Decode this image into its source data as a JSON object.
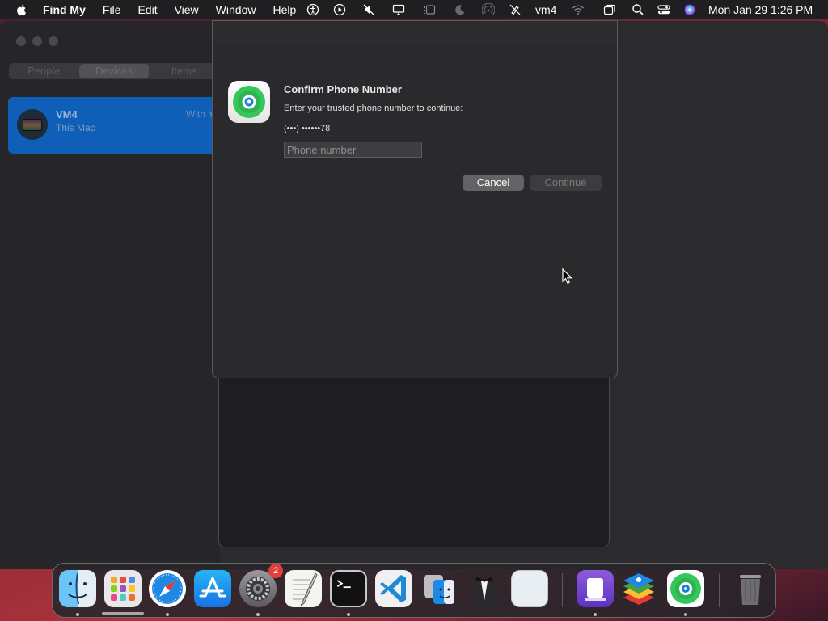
{
  "menubar": {
    "app_name": "Find My",
    "menus": [
      "File",
      "Edit",
      "View",
      "Window",
      "Help"
    ],
    "user": "vm4",
    "datetime": "Mon Jan 29  1:26 PM"
  },
  "sidebar": {
    "tabs": [
      "People",
      "Devices",
      "Items"
    ],
    "active_tab": "Devices",
    "device": {
      "name": "VM4",
      "subtitle": "This Mac",
      "status": "With Y"
    }
  },
  "dialog": {
    "title": "Confirm Phone Number",
    "message": "Enter your trusted phone number to continue:",
    "masked_phone": "(•••) ••••••78",
    "input_placeholder": "Phone number",
    "input_value": "",
    "cancel_label": "Cancel",
    "continue_label": "Continue"
  },
  "dock": {
    "apps": [
      {
        "name": "Finder",
        "running": true
      },
      {
        "name": "Launchpad",
        "running": false
      },
      {
        "name": "Safari",
        "running": true
      },
      {
        "name": "App Store",
        "running": false
      },
      {
        "name": "System Settings",
        "running": true,
        "badge": "2"
      },
      {
        "name": "TextEdit",
        "running": false
      },
      {
        "name": "Terminal",
        "running": true
      },
      {
        "name": "Visual Studio Code",
        "running": false
      },
      {
        "name": "Migration Assistant",
        "running": false
      },
      {
        "name": "Bartender",
        "running": false
      },
      {
        "name": "Preview",
        "running": false
      },
      {
        "name": "Simulator",
        "running": true
      },
      {
        "name": "BlueStacks",
        "running": false
      },
      {
        "name": "Find My",
        "running": true
      },
      {
        "name": "Trash",
        "running": false
      }
    ]
  },
  "colors": {
    "accent_blue": "#0f5fb8",
    "badge_red": "#e0413a",
    "findmy_green": "#34c759"
  }
}
